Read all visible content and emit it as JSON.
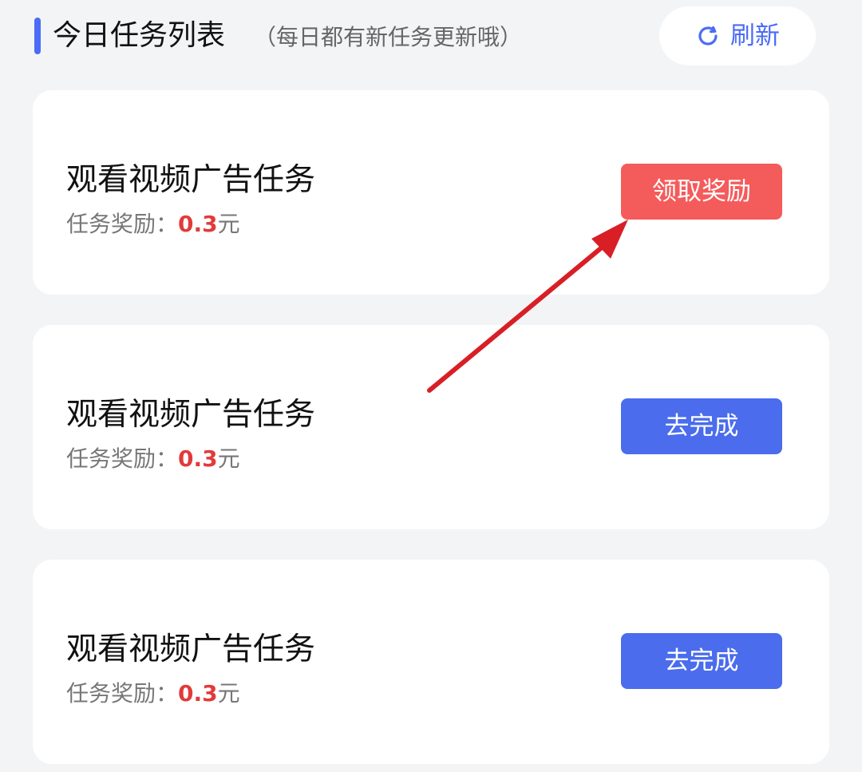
{
  "header": {
    "title": "今日任务列表",
    "subtitle": "（每日都有新任务更新哦）",
    "refresh_label": "刷新"
  },
  "tasks": [
    {
      "title": "观看视频广告任务",
      "reward_label": "任务奖励：",
      "reward_amount": "0.3",
      "reward_unit": "元",
      "button_label": "领取奖励",
      "button_state": "claim"
    },
    {
      "title": "观看视频广告任务",
      "reward_label": "任务奖励：",
      "reward_amount": "0.3",
      "reward_unit": "元",
      "button_label": "去完成",
      "button_state": "go"
    },
    {
      "title": "观看视频广告任务",
      "reward_label": "任务奖励：",
      "reward_amount": "0.3",
      "reward_unit": "元",
      "button_label": "去完成",
      "button_state": "go"
    }
  ],
  "colors": {
    "accent": "#4a6cf7",
    "claim_button": "#f45b5b",
    "go_button": "#4a6ced",
    "reward_amount": "#e23a3a",
    "annotation_arrow": "#d81f26"
  },
  "icons": {
    "refresh": "refresh-icon"
  }
}
